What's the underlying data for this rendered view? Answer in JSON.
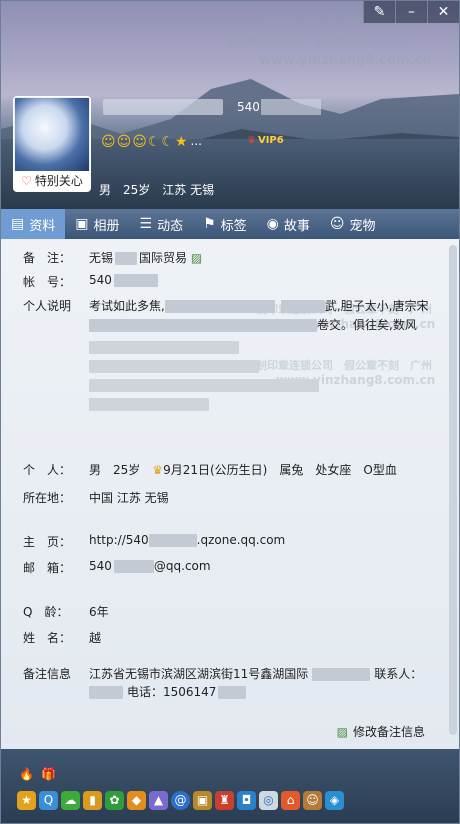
{
  "window": {
    "buttons": [
      "✎",
      "–",
      "✕"
    ]
  },
  "profile": {
    "nickname_number": "540",
    "favorite_label": "特别关心",
    "level_icons": [
      "☺",
      "☺",
      "☺",
      "☾",
      "☾",
      "★"
    ],
    "level_more": "...",
    "vip_label": "VIP6",
    "gender": "男",
    "age": "25岁",
    "location": "江苏 无锡"
  },
  "tabs": [
    {
      "icon": "▤",
      "label": "资料"
    },
    {
      "icon": "▣",
      "label": "相册"
    },
    {
      "icon": "☰",
      "label": "动态"
    },
    {
      "icon": "⚑",
      "label": "标签"
    },
    {
      "icon": "◉",
      "label": "故事"
    },
    {
      "icon": "☺",
      "label": "宠物"
    }
  ],
  "info": {
    "remark_label": "备　注：",
    "remark_prefix": "无锡",
    "remark_suffix": "国际贸易",
    "account_label": "帐　号：",
    "account_value": "540",
    "desc_label": "个人说明",
    "desc_line1_a": "考试如此多焦,",
    "desc_line1_b": "武,胆子太小,唐宗宋",
    "desc_line2_b": "卷交。俱往矣,数风",
    "personal_label": "个　人：",
    "personal_gender": "男",
    "personal_age": "25岁",
    "personal_birthday": "9月21日(公历生日)",
    "personal_zodiac": "属兔",
    "personal_sign": "处女座",
    "personal_blood": "O型血",
    "location_label": "所在地：",
    "location_value": "中国 江苏 无锡",
    "homepage_label": "主　页：",
    "homepage_prefix": "http://540",
    "homepage_suffix": ".qzone.qq.com",
    "email_label": "邮　箱：",
    "email_prefix": "540",
    "email_suffix": "@qq.com",
    "qage_label": "Q　龄：",
    "qage_value": "6年",
    "name_label": "姓　名：",
    "name_value": "越",
    "note_label": "备注信息",
    "note_line1": "江苏省无锡市滨湖区湖滨街11号鑫湖国际",
    "note_contact": "联系人：",
    "note_phone": "电话：1506147",
    "edit_label": "修改备注信息"
  },
  "watermark": [
    "www.yinzhang8.com.cn",
    "制印章连锁公司　假公章不刻　广州"
  ],
  "footer": {
    "row1": [
      "🔥",
      "🎁"
    ],
    "row2": [
      "★",
      "Q",
      "☁",
      "▮",
      "✿",
      "◆",
      "▲",
      "@",
      "▣",
      "♜",
      "◘",
      "◎",
      "⌂",
      "☺",
      "◈"
    ]
  },
  "colors": {
    "tab_active": "#6f9cd2",
    "tab_bar": "#4a6585",
    "footer": "#34485f"
  }
}
